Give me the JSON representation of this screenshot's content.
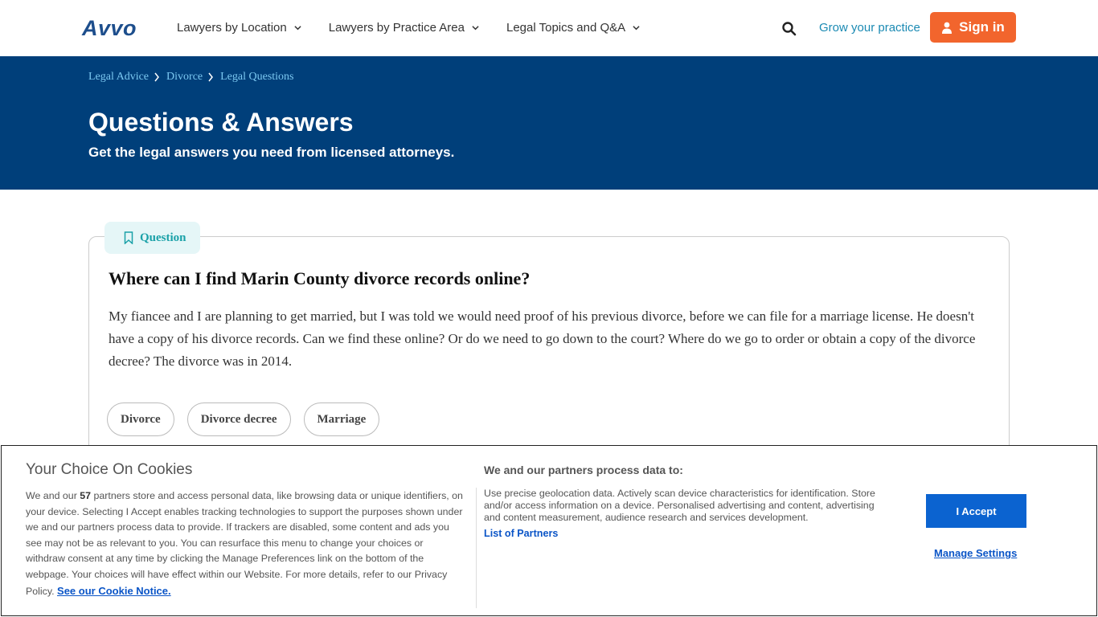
{
  "header": {
    "logo": "Avvo",
    "nav": [
      {
        "label": "Lawyers by Location"
      },
      {
        "label": "Lawyers by Practice Area"
      },
      {
        "label": "Legal Topics and Q&A"
      }
    ],
    "grow_link": "Grow your practice",
    "signin_label": "Sign in"
  },
  "hero": {
    "breadcrumb": [
      "Legal Advice",
      "Divorce",
      "Legal Questions"
    ],
    "title": "Questions & Answers",
    "subtitle": "Get the legal answers you need from licensed attorneys."
  },
  "question": {
    "tag_label": "Question",
    "title": "Where can I find Marin County divorce records online?",
    "body": "My fiancee and I are planning to get married, but I was told we would need proof of his previous divorce, before we can file for a marriage license. He doesn't have a copy of his divorce records. Can we find these online? Or do we need to go down to the court? Where do we go to order or obtain a copy of the divorce decree? The divorce was in 2014.",
    "tags": [
      "Divorce",
      "Divorce decree",
      "Marriage"
    ]
  },
  "cookie": {
    "title": "Your Choice On Cookies",
    "text_before": "We and our ",
    "partner_count": "57",
    "text_after": " partners store and access personal data, like browsing data or unique identifiers, on your device. Selecting I Accept enables tracking technologies to support the purposes shown under we and our partners process data to provide. If trackers are disabled, some content and ads you see may not be as relevant to you. You can resurface this menu to change your choices or withdraw consent at any time by clicking the Manage Preferences link on the bottom of the webpage. Your choices will have effect within our Website. For more details, refer to our Privacy Policy. ",
    "notice_link": "See our Cookie Notice.",
    "purpose_title": "We and our partners process data to:",
    "purpose_text": "Use precise geolocation data. Actively scan device characteristics for identification. Store and/or access information on a device. Personalised advertising and content, advertising and content measurement, audience research and services development.",
    "partners_link": "List of Partners",
    "accept_label": "I Accept",
    "manage_label": "Manage Settings"
  },
  "colors": {
    "brand_blue": "#003f7a",
    "signin_orange": "#f2652d",
    "accept_blue": "#0b63d0",
    "teal": "#1aa1a8"
  }
}
